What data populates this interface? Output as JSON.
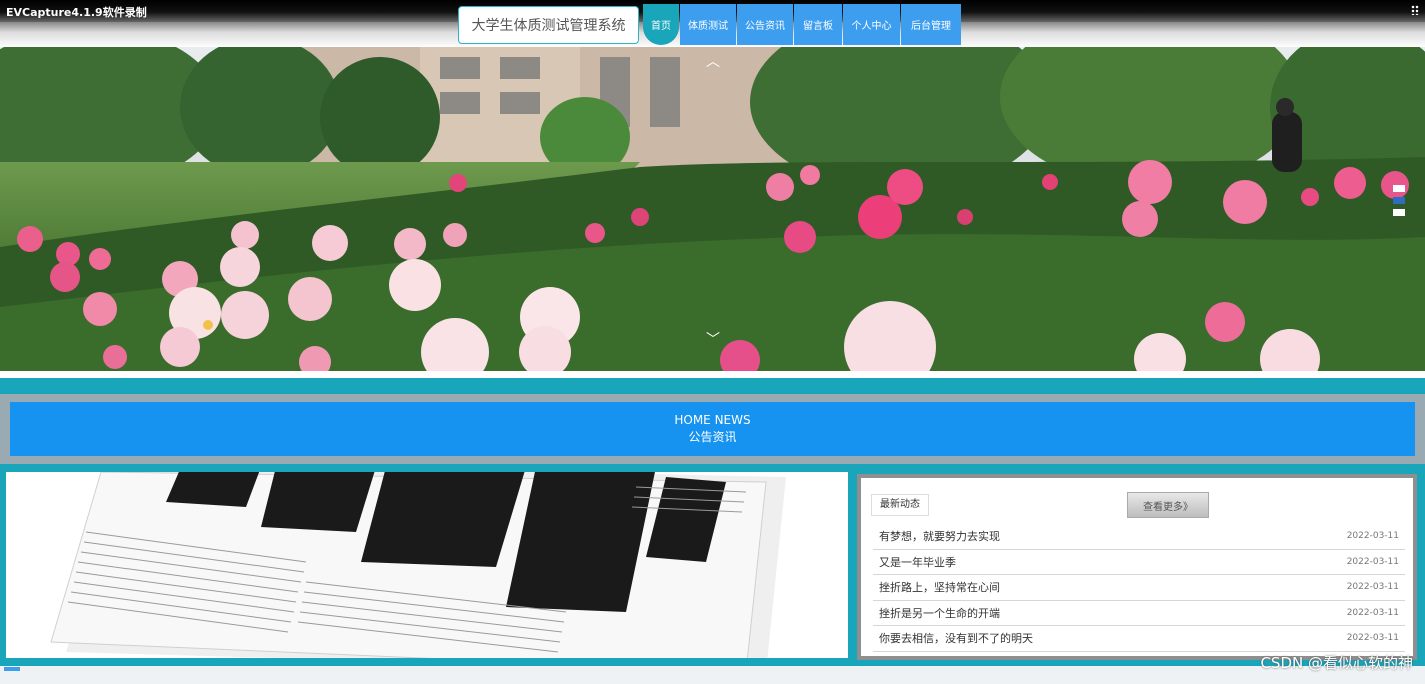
{
  "capture": {
    "title": "EVCapture4.1.9软件录制"
  },
  "site": {
    "title": "大学生体质测试管理系统"
  },
  "nav": {
    "items": [
      {
        "label": "首页",
        "active": true
      },
      {
        "label": "体质测试",
        "active": false
      },
      {
        "label": "公告资讯",
        "active": false
      },
      {
        "label": "留言板",
        "active": false
      },
      {
        "label": "个人中心",
        "active": false
      },
      {
        "label": "后台管理",
        "active": false
      }
    ]
  },
  "banner": {
    "icons": [
      "chevron-up-icon",
      "chevron-down-icon"
    ]
  },
  "news_section": {
    "title_en": "HOME NEWS",
    "title_cn": "公告资讯"
  },
  "news_list": {
    "tag": "最新动态",
    "more_label": "查看更多》",
    "items": [
      {
        "title": "有梦想，就要努力去实现",
        "date": "2022-03-11"
      },
      {
        "title": "又是一年毕业季",
        "date": "2022-03-11"
      },
      {
        "title": "挫折路上，坚持常在心间",
        "date": "2022-03-11"
      },
      {
        "title": "挫折是另一个生命的开端",
        "date": "2022-03-11"
      },
      {
        "title": "你要去相信，没有到不了的明天",
        "date": "2022-03-11"
      }
    ]
  },
  "watermark": "CSDN @看似心软的神",
  "colors": {
    "teal": "#19a5ba",
    "blue": "#3d9ef0",
    "news_blue": "#1692f0"
  }
}
